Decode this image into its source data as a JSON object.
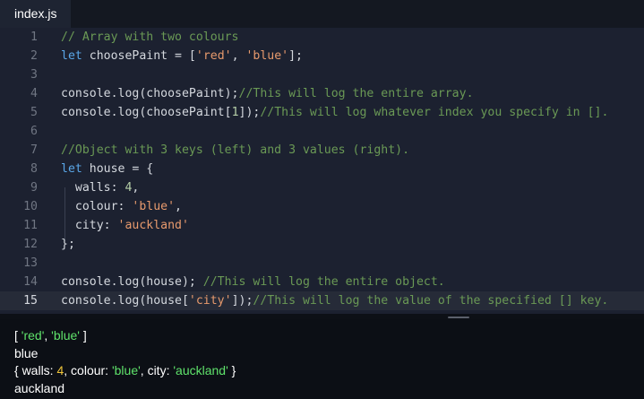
{
  "tab": {
    "filename": "index.js"
  },
  "editor": {
    "active_line": 15,
    "lines": [
      {
        "num": "1",
        "tokens": [
          [
            "c-comment",
            "// Array with two colours"
          ]
        ]
      },
      {
        "num": "2",
        "tokens": [
          [
            "c-kw",
            "let"
          ],
          [
            "c-plain",
            " choosePaint = ["
          ],
          [
            "c-str",
            "'red'"
          ],
          [
            "c-plain",
            ", "
          ],
          [
            "c-str",
            "'blue'"
          ],
          [
            "c-plain",
            "];"
          ]
        ]
      },
      {
        "num": "3",
        "tokens": []
      },
      {
        "num": "4",
        "tokens": [
          [
            "c-plain",
            "console.log(choosePaint);"
          ],
          [
            "c-comment",
            "//This will log the entire array."
          ]
        ]
      },
      {
        "num": "5",
        "tokens": [
          [
            "c-plain",
            "console.log(choosePaint["
          ],
          [
            "c-num",
            "1"
          ],
          [
            "c-plain",
            "]);"
          ],
          [
            "c-comment",
            "//This will log whatever index you specify in []."
          ]
        ]
      },
      {
        "num": "6",
        "tokens": []
      },
      {
        "num": "7",
        "tokens": [
          [
            "c-comment",
            "//Object with 3 keys (left) and 3 values (right)."
          ]
        ]
      },
      {
        "num": "8",
        "tokens": [
          [
            "c-kw",
            "let"
          ],
          [
            "c-plain",
            " house = {"
          ]
        ]
      },
      {
        "num": "9",
        "tokens": [
          [
            "c-plain",
            "  walls: "
          ],
          [
            "c-num",
            "4"
          ],
          [
            "c-plain",
            ","
          ]
        ]
      },
      {
        "num": "10",
        "tokens": [
          [
            "c-plain",
            "  colour: "
          ],
          [
            "c-str",
            "'blue'"
          ],
          [
            "c-plain",
            ","
          ]
        ]
      },
      {
        "num": "11",
        "tokens": [
          [
            "c-plain",
            "  city: "
          ],
          [
            "c-str",
            "'auckland'"
          ]
        ]
      },
      {
        "num": "12",
        "tokens": [
          [
            "c-plain",
            "};"
          ]
        ]
      },
      {
        "num": "13",
        "tokens": []
      },
      {
        "num": "14",
        "tokens": [
          [
            "c-plain",
            "console.log(house); "
          ],
          [
            "c-comment",
            "//This will log the entire object."
          ]
        ]
      },
      {
        "num": "15",
        "tokens": [
          [
            "c-plain",
            "console.log(house["
          ],
          [
            "c-str",
            "'city'"
          ],
          [
            "c-plain",
            "]);"
          ],
          [
            "c-comment",
            "//This will log the value of the specified [] key."
          ]
        ]
      }
    ]
  },
  "console": {
    "lines": [
      {
        "tokens": [
          [
            "o-plain",
            "[ "
          ],
          [
            "o-str",
            "'red'"
          ],
          [
            "o-plain",
            ", "
          ],
          [
            "o-str",
            "'blue'"
          ],
          [
            "o-plain",
            " ]"
          ]
        ]
      },
      {
        "tokens": [
          [
            "o-plain",
            "blue"
          ]
        ]
      },
      {
        "tokens": [
          [
            "o-plain",
            "{ walls: "
          ],
          [
            "o-num",
            "4"
          ],
          [
            "o-plain",
            ", colour: "
          ],
          [
            "o-str",
            "'blue'"
          ],
          [
            "o-plain",
            ", city: "
          ],
          [
            "o-str",
            "'auckland'"
          ],
          [
            "o-plain",
            " }"
          ]
        ]
      },
      {
        "tokens": [
          [
            "o-plain",
            "auckland"
          ]
        ]
      }
    ]
  },
  "colors": {
    "editor_bg": "#1c2130",
    "console_bg": "#0c0f15",
    "keyword": "#5aa7e8",
    "string": "#e79a6d",
    "comment": "#6a9955",
    "console_string": "#5fe36b",
    "console_number": "#f0c53a"
  }
}
